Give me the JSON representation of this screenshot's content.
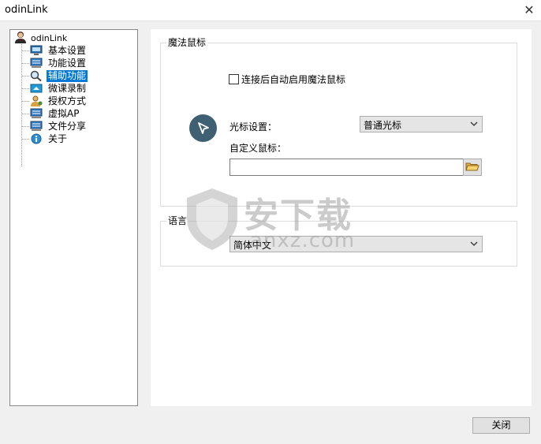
{
  "window": {
    "title": "odinLink",
    "close_glyph": "✕"
  },
  "tree": {
    "root": {
      "label": "odinLink",
      "icon": "user-avatar-icon"
    },
    "items": [
      {
        "label": "基本设置",
        "icon": "monitor-icon",
        "selected": false
      },
      {
        "label": "功能设置",
        "icon": "keyboard-icon",
        "selected": false
      },
      {
        "label": "辅助功能",
        "icon": "magnifier-icon",
        "selected": true
      },
      {
        "label": "微课录制",
        "icon": "screen-record-icon",
        "selected": false
      },
      {
        "label": "授权方式",
        "icon": "license-user-icon",
        "selected": false
      },
      {
        "label": "虚拟AP",
        "icon": "keyboard-icon",
        "selected": false
      },
      {
        "label": "文件分享",
        "icon": "keyboard-icon",
        "selected": false
      },
      {
        "label": "关于",
        "icon": "info-icon",
        "selected": false
      }
    ]
  },
  "magic_mouse": {
    "title": "魔法鼠标",
    "auto_enable_label": "连接后自动启用魔法鼠标",
    "auto_enable_checked": false,
    "cursor_setting_label": "光标设置：",
    "cursor_setting_value": "普通光标",
    "custom_cursor_label": "自定义鼠标：",
    "custom_cursor_value": ""
  },
  "language": {
    "title": "语言",
    "value": "简体中文"
  },
  "watermark": {
    "text": "安下载",
    "sub": "anxz.com"
  },
  "footer": {
    "close_label": "关闭"
  },
  "colors": {
    "selection": "#0078d7",
    "badge": "#3f5f72"
  }
}
